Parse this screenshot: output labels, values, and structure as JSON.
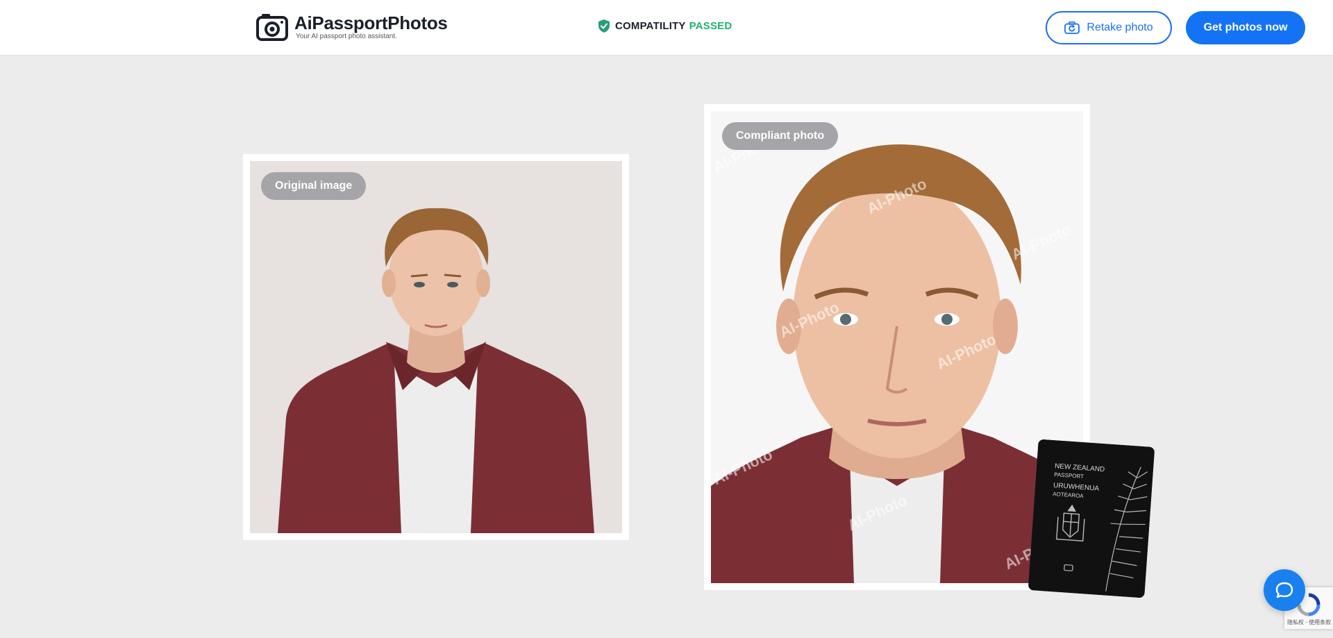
{
  "header": {
    "brand_title": "AiPassportPhotos",
    "brand_subtitle": "Your AI passport photo assistant.",
    "compat_label": "COMPATILITY",
    "compat_status": "PASSED",
    "retake_label": "Retake photo",
    "get_label": "Get photos now"
  },
  "original": {
    "badge": "Original image"
  },
  "compliant": {
    "badge": "Compliant photo",
    "watermark": "AI-Photo"
  },
  "passport": {
    "line1": "NEW ZEALAND",
    "line2": "PASSPORT",
    "line3": "URUWHENUA",
    "line4": "AOTEAROA"
  },
  "recaptcha": {
    "text": "隐私权 - 使用条款"
  },
  "icons": {
    "logo": "camera-logo-icon",
    "compat": "shield-check-icon",
    "retake": "camera-retake-icon",
    "chat": "chat-bubble-icon"
  },
  "colors": {
    "primary": "#1473f5",
    "passed": "#20b26b",
    "background": "#ececec",
    "badge": "#a5a5a9"
  }
}
